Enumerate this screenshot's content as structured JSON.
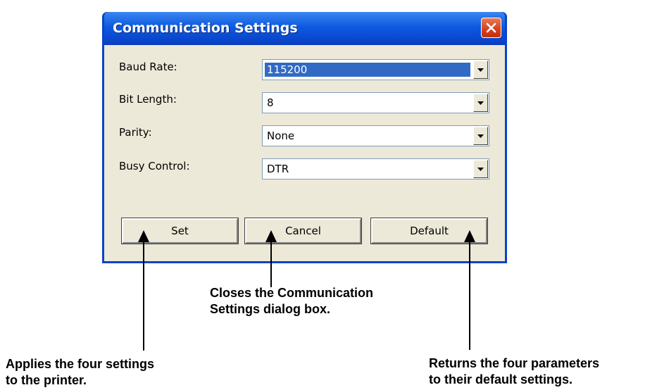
{
  "dialog": {
    "title": "Communication Settings",
    "fields": [
      {
        "label": "Baud Rate:",
        "value": "115200",
        "selected": true
      },
      {
        "label": "Bit Length:",
        "value": "8",
        "selected": false
      },
      {
        "label": "Parity:",
        "value": "None",
        "selected": false
      },
      {
        "label": "Busy Control:",
        "value": "DTR",
        "selected": false
      }
    ],
    "buttons": {
      "set": "Set",
      "cancel": "Cancel",
      "default": "Default"
    }
  },
  "callouts": {
    "cancel_line1": "Closes the Communication",
    "cancel_line2": "Settings dialog box.",
    "set_line1": "Applies the four settings",
    "set_line2": "to the printer.",
    "default_line1": "Returns the four parameters",
    "default_line2": "to their default settings."
  },
  "colors": {
    "title_bar": "#0a48d0",
    "close_button": "#d4401c",
    "selection": "#316ac5",
    "dialog_face": "#ece9d8"
  },
  "icons": {
    "close": "close-x-icon",
    "dropdown": "chevron-down-icon",
    "pointer": "arrow-up-icon"
  }
}
